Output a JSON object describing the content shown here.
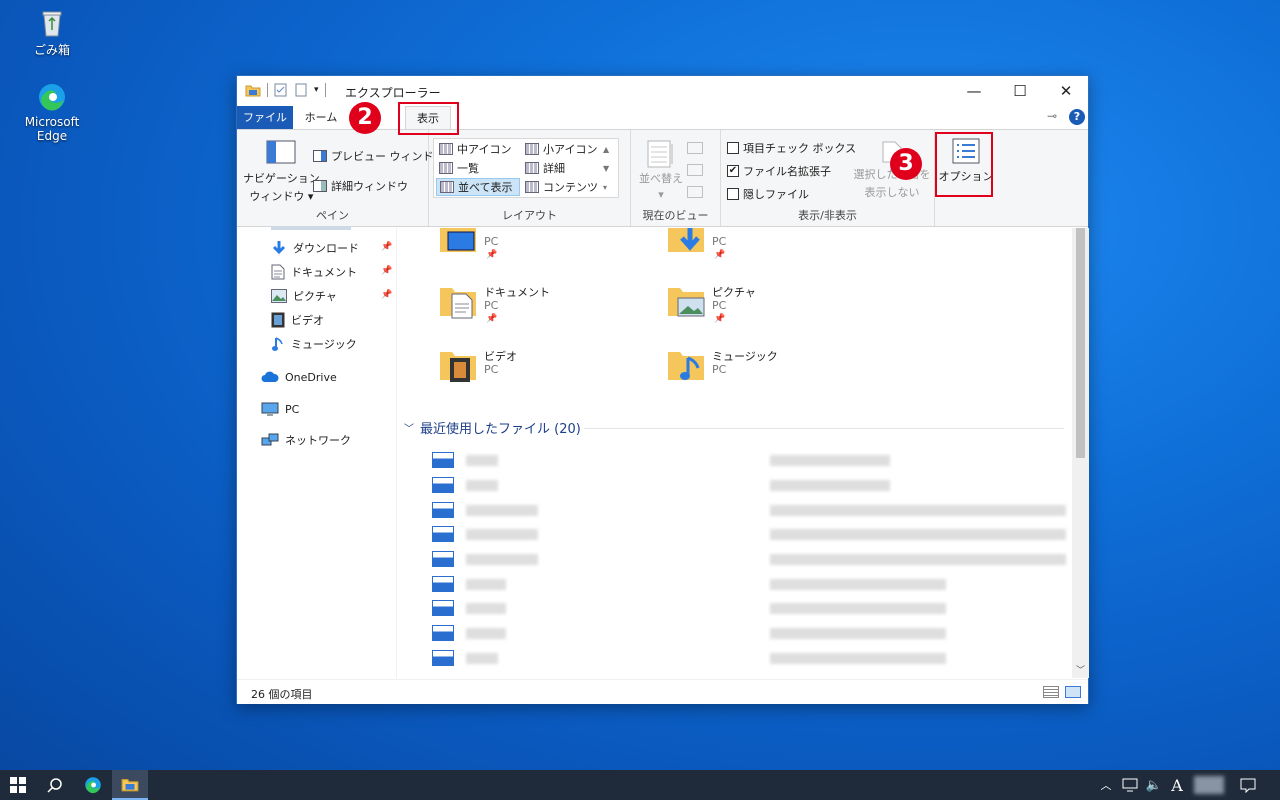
{
  "desktop": {
    "recycle_bin": "ごみ箱",
    "edge": "Microsoft Edge"
  },
  "window": {
    "title": "エクスプローラー",
    "controls": {
      "minimize": "—",
      "maximize": "☐",
      "close": "✕"
    }
  },
  "tabs": {
    "file": "ファイル",
    "home": "ホーム",
    "view": "表示"
  },
  "ribbon": {
    "pane": {
      "label": "ペイン",
      "nav_pane_line1": "ナビゲーション",
      "nav_pane_line2": "ウィンドウ ▾",
      "preview_pane": "プレビュー ウィンドウ",
      "details_pane": "詳細ウィンドウ"
    },
    "layout": {
      "label": "レイアウト",
      "items": [
        "中アイコン",
        "小アイコン",
        "一覧",
        "詳細",
        "並べて表示",
        "コンテンツ"
      ]
    },
    "current_view": {
      "label": "現在のビュー",
      "sort_line1": "並べ替え",
      "sort_line2": "▾"
    },
    "show_hide": {
      "label": "表示/非表示",
      "item_checkboxes": "項目チェック ボックス",
      "file_ext": "ファイル名拡張子",
      "hidden_files": "隠しファイル",
      "hide_selected_line1": "選択した項目を",
      "hide_selected_line2": "表示しない",
      "file_ext_checked": "✔"
    },
    "options": "オプション"
  },
  "nav_pane": {
    "items": [
      "ダウンロード",
      "ドキュメント",
      "ピクチャ",
      "ビデオ",
      "ミュージック",
      "OneDrive",
      "PC",
      "ネットワーク"
    ]
  },
  "content": {
    "tiles": [
      {
        "name": "",
        "sub": "PC"
      },
      {
        "name": "",
        "sub": "PC"
      },
      {
        "name": "ドキュメント",
        "sub": "PC"
      },
      {
        "name": "ピクチャ",
        "sub": "PC"
      },
      {
        "name": "ビデオ",
        "sub": "PC"
      },
      {
        "name": "ミュージック",
        "sub": "PC"
      }
    ],
    "recent_header": "最近使用したファイル (20)"
  },
  "statusbar": {
    "count": "26 個の項目"
  },
  "annotations": {
    "step2": "2",
    "step3": "3"
  },
  "taskbar": {
    "ime": "A"
  },
  "colors": {
    "accent": "#1b5bb8",
    "annotation": "#e0001b",
    "folder": "#f4c65b"
  }
}
